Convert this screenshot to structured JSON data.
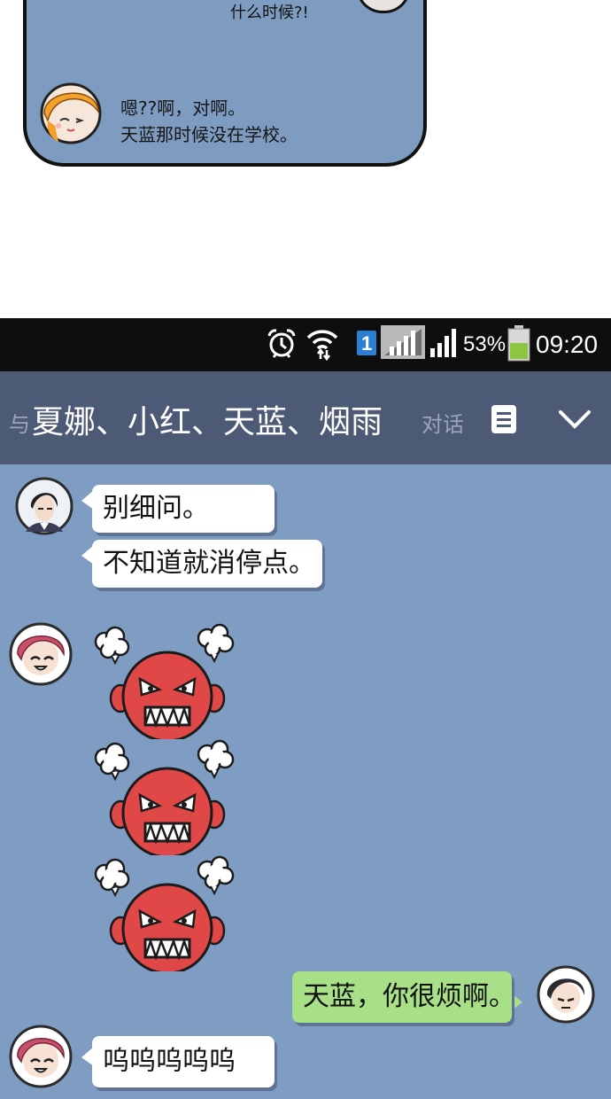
{
  "top_panel": {
    "partial_text": "什么时候?!",
    "message_lines": [
      "嗯??啊，对啊。",
      "天蓝那时候没在学校。"
    ]
  },
  "status_bar": {
    "icons": [
      "alarm-icon",
      "wifi-icon",
      "sim-1-badge",
      "signal-icon-1",
      "signal-icon-2",
      "battery-icon"
    ],
    "sim_label": "1",
    "battery_percent": "53%",
    "battery_level": 0.53,
    "time": "09:20"
  },
  "chat_header": {
    "prefix": "与",
    "participants": "夏娜、小红、天蓝、烟雨",
    "suffix": "对话",
    "icons": [
      "memo-icon",
      "chevron-down-icon"
    ]
  },
  "messages": [
    {
      "sender": "dark-hair-boy",
      "side": "left",
      "text": "别细问。"
    },
    {
      "sender": "dark-hair-boy",
      "side": "left",
      "text": "不知道就消停点。"
    },
    {
      "sender": "pink-hair-boy",
      "side": "left",
      "sticker": "angry-face-sticker",
      "count": 3
    },
    {
      "sender": "me",
      "side": "right",
      "text": "天蓝，你很烦啊。"
    },
    {
      "sender": "pink-hair-boy",
      "side": "left",
      "text": "呜呜呜呜呜"
    }
  ],
  "colors": {
    "chat_background": "#7f9cc3",
    "header_background": "#4d5a75",
    "status_bar": "#0e0e0e",
    "bubble_other": "#ffffff",
    "bubble_self": "#a8e088",
    "sticker_red": "#e04848"
  }
}
